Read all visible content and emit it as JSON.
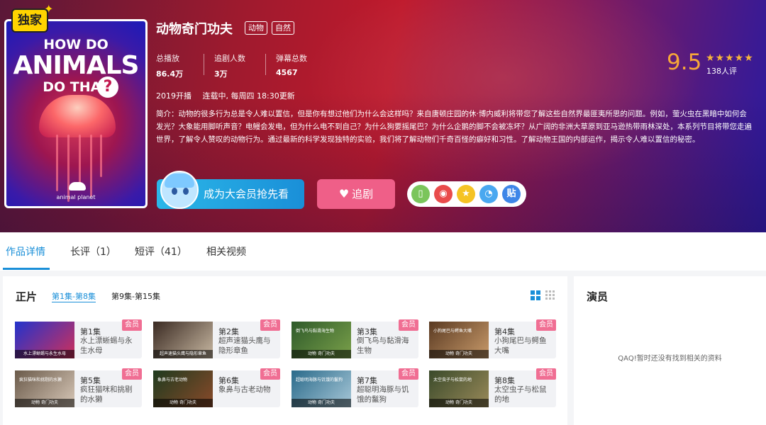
{
  "hero": {
    "badge": "独家",
    "title": "动物奇门功夫",
    "tags": [
      "动物",
      "自然"
    ],
    "stats": [
      {
        "label": "总播放",
        "value": "86.4万"
      },
      {
        "label": "追剧人数",
        "value": "3万"
      },
      {
        "label": "弹幕总数",
        "value": "4567"
      }
    ],
    "rating": "9.5",
    "stars": "★★★★★",
    "rating_count": "138人评",
    "premiere": "2019开播",
    "update": "连载中, 每周四 18:30更新",
    "summary": "简介：动物的很多行为总是令人难以置信，但是你有想过他们为什么会这样吗？来自唐顿庄园的休·博内威利将带您了解这些自然界最匪夷所思的问题。例如，萤火虫在黑暗中如何会发光？大象能用脚听声音？电鳗会发电，但为什么电不到自己？为什么狗要摇尾巴？为什么企鹅的脚不会被冻坏？从广阔的非洲大草原到亚马逊热带雨林深处，本系列节目将带您走遍世界，了解令人赞叹的动物行为。通过最新的科学发现独特的实验，我们将了解动物们千奇百怪的癖好和习性。了解动物王国的内部运作，揭示令人难以置信的秘密。",
    "poster": {
      "line1": "HOW DO",
      "line2": "ANIMALS",
      "line3": "DO THAT",
      "qmark": "?",
      "brand": "animal planet"
    },
    "vip_button": "成为大会员抢先看",
    "follow_button": "追剧",
    "share_icons": [
      "phone-icon",
      "weibo-icon",
      "qzone-icon",
      "qq-icon",
      "tieba-icon"
    ],
    "share_tieba": "贴"
  },
  "tabs": [
    "作品详情",
    "长评（1）",
    "短评（41）",
    "相关视频"
  ],
  "episodes": {
    "title": "正片",
    "ranges": [
      "第1集-第8集",
      "第9集-第15集"
    ],
    "vip_label": "会员",
    "items": [
      {
        "num": "第1集",
        "name": "水上漂蜥蜴与永生水母",
        "thumb": "水上漂蜥蜴与永生水母"
      },
      {
        "num": "第2集",
        "name": "超声速猫头鹰与隐形章鱼",
        "thumb": "超声速猫头鹰与隐形章鱼"
      },
      {
        "num": "第3集",
        "name": "倒飞鸟与黏滑海生物",
        "thumb": "倒飞鸟与黏滑海生物"
      },
      {
        "num": "第4集",
        "name": "小狗尾巴与鳄鱼大嘴",
        "thumb": "小狗尾巴与鳄鱼大嘴"
      },
      {
        "num": "第5集",
        "name": "疯狂猫咪和挑剔的水獭",
        "thumb": "疯狂猫咪和挑剔的水獭"
      },
      {
        "num": "第6集",
        "name": "象鼻与古老动物",
        "thumb": "象鼻与古老动物"
      },
      {
        "num": "第7集",
        "name": "超聪明海豚与饥饿的鬣狗",
        "thumb": "超聪明海豚与饥饿的鬣狗"
      },
      {
        "num": "第8集",
        "name": "太空虫子与松鼠的地",
        "thumb": "太空虫子与松鼠的地"
      }
    ],
    "thumb_brand": "动物 奇门功夫"
  },
  "cast": {
    "title": "演员",
    "empty": "QAQ!暂时还没有找到相关的资料"
  },
  "colors": {
    "accent": "#1a8fd8",
    "vip": "#f06e93",
    "rating": "#f7a739"
  }
}
